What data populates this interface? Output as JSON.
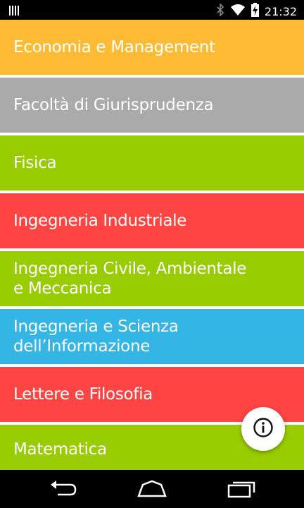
{
  "status_bar": {
    "time": "21:32",
    "icons": [
      "signal-bars-icon",
      "bluetooth-icon",
      "wifi-icon",
      "battery-charging-icon"
    ]
  },
  "list": {
    "items": [
      {
        "label": "Economia e Management",
        "color": "#FFBB33"
      },
      {
        "label": "Facoltà di Giurisprudenza",
        "color": "#AAAAAA"
      },
      {
        "label": "Fisica",
        "color": "#99CC00"
      },
      {
        "label": "Ingegneria Industriale",
        "color": "#FF4444"
      },
      {
        "label": "Ingegneria Civile, Ambientale e Meccanica",
        "color": "#99CC00"
      },
      {
        "label": "Ingegneria e Scienza dell’Informazione",
        "color": "#33B5E5"
      },
      {
        "label": "Lettere e Filosofia",
        "color": "#FF4444"
      },
      {
        "label": "Matematica",
        "color": "#99CC00"
      }
    ]
  },
  "fab": {
    "icon": "info-icon"
  },
  "nav_bar": {
    "icons": [
      "back-icon",
      "home-icon",
      "recents-icon"
    ]
  }
}
